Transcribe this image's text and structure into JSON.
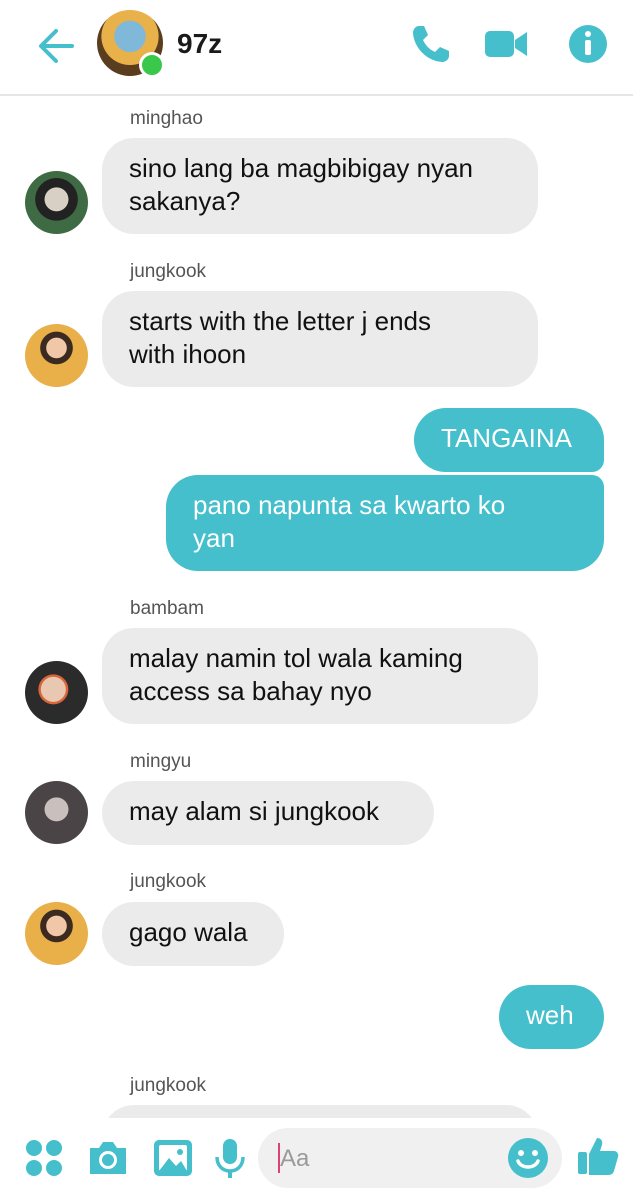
{
  "header": {
    "title": "97z",
    "back_icon": "arrow-left-icon",
    "call_icon": "phone-icon",
    "video_icon": "video-camera-icon",
    "info_icon": "info-icon"
  },
  "messages": [
    {
      "sender": "minghao",
      "text": "sino lang ba magbibigay nyan\nsakanya?"
    },
    {
      "sender": "jungkook",
      "text": "starts with the letter j ends\nwith ihoon"
    },
    {
      "outgoing": true,
      "text": "TANGAINA"
    },
    {
      "outgoing": true,
      "text": "pano napunta sa kwarto ko\nyan"
    },
    {
      "sender": "bambam",
      "text": "malay namin tol wala kaming\naccess sa bahay nyo"
    },
    {
      "sender": "mingyu",
      "text": "may alam si jungkook"
    },
    {
      "sender": "jungkook",
      "text": "gago wala"
    },
    {
      "outgoing": true,
      "text": "weh"
    },
    {
      "sender": "jungkook",
      "text": ""
    }
  ],
  "composer": {
    "placeholder": "Aa",
    "icons": [
      "more-apps-icon",
      "camera-icon",
      "image-icon",
      "microphone-icon",
      "emoji-icon",
      "thumbs-up-icon"
    ]
  },
  "colors": {
    "accent": "#45bfcb",
    "incoming_bubble": "#ebebeb",
    "online": "#3ac84a"
  }
}
